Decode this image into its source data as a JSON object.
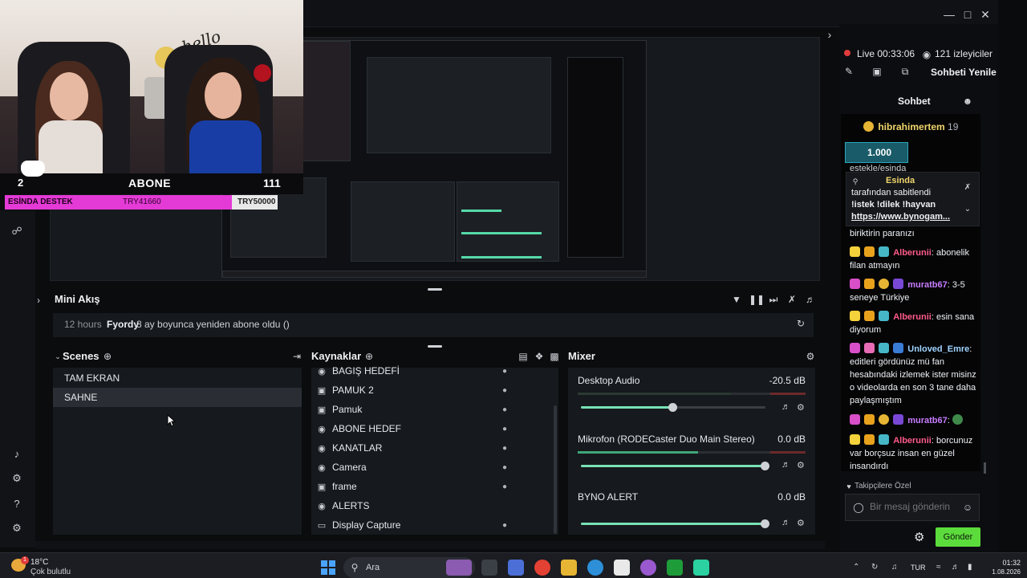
{
  "overlay": {
    "abone_left": "2",
    "abone_label": "ABONE",
    "abone_count": "111",
    "destek_label": "ESİNDA DESTEK",
    "destek_value": "TRY41660",
    "destek_target": "TRY50000",
    "destek_progress": 0.8332,
    "cam_text": "hello"
  },
  "mini_akis": {
    "title": "Mini Akış",
    "time": "12 hours",
    "user": "Fyordy",
    "message": "8 ay boyunca yeniden abone oldu ()"
  },
  "scenes": {
    "title": "Scenes",
    "items": [
      {
        "label": "TAM EKRAN",
        "active": false
      },
      {
        "label": "SAHNE",
        "active": true
      }
    ]
  },
  "sources": {
    "title": "Kaynaklar",
    "items": [
      {
        "label": "BAGIŞ HEDEFİ",
        "icon": "globe-icon",
        "locked": true
      },
      {
        "label": "PAMUK 2",
        "icon": "image-icon",
        "locked": true
      },
      {
        "label": "Pamuk",
        "icon": "image-icon",
        "locked": true
      },
      {
        "label": "ABONE HEDEF",
        "icon": "globe-icon",
        "locked": true
      },
      {
        "label": "KANATLAR",
        "icon": "globe-icon",
        "locked": true
      },
      {
        "label": "Camera",
        "icon": "camera-icon",
        "locked": true
      },
      {
        "label": "frame",
        "icon": "image-icon",
        "locked": true
      },
      {
        "label": "ALERTS",
        "icon": "globe-icon",
        "locked": false
      },
      {
        "label": "Display Capture",
        "icon": "monitor-icon",
        "locked": true
      }
    ]
  },
  "mixer": {
    "title": "Mixer",
    "channels": [
      {
        "name": "Desktop Audio",
        "db": "-20.5 dB",
        "level": 0.5
      },
      {
        "name": "Mikrofon (RODECaster Duo Main Stereo)",
        "db": "0.0 dB",
        "level": 1.0
      },
      {
        "name": "BYNO ALERT",
        "db": "0.0 dB",
        "level": 1.0
      }
    ]
  },
  "stream": {
    "live_label": "Live 00:33:06",
    "viewers": "121 izleyiciler",
    "refresh_chat": "Sohbeti Yenile",
    "chat_title": "Sohbet"
  },
  "chat": {
    "top_user": "hibrahimertem",
    "top_user_suffix": "19",
    "goal_value": "1.000",
    "partial_line": "estekle/esinda",
    "pinned_user": "Esinda",
    "pinned_text_1": "tarafından sabitlendi",
    "pinned_text_2": "!istek !dilek !hayvan",
    "pinned_link": "https://www.bynogam...",
    "after_pin": "biriktirin paranızı",
    "messages": [
      {
        "user": "Alberunii",
        "text": "abonelik filan atmayın",
        "badge": "16"
      },
      {
        "user": "muratb67",
        "text": "3-5 seneye Türkiye",
        "badge": "20"
      },
      {
        "user": "Alberunii",
        "text": "esin sana diyorum",
        "badge": "16"
      },
      {
        "user": "Unloved_Emre",
        "text": "editleri gördünüz mü fan hesabındaki izlemek ister misinz o videolarda en son 3 tane daha paylaşmıştım",
        "badge": "21"
      },
      {
        "user": "muratb67",
        "text": "",
        "badge": "20"
      },
      {
        "user": "Alberunii",
        "text": "borcunuz var borçsuz insan en güzel insandırdı",
        "badge": "16"
      }
    ],
    "followers_only": "Takipçilere Özel",
    "input_placeholder": "Bir mesaj gönderin",
    "send_label": "Gönder"
  },
  "taskbar": {
    "temp": "18°C",
    "weather": "Çok bulutlu",
    "weather_badge": "1",
    "search_label": "Ara",
    "lang": "TUR",
    "time": "01:32",
    "date": "1.08.2026"
  },
  "colors": {
    "accent_green": "#5cdc3c",
    "slider_green": "#78e2b5",
    "destek_magenta": "#e43ad6",
    "live_red": "#e23b3b"
  }
}
